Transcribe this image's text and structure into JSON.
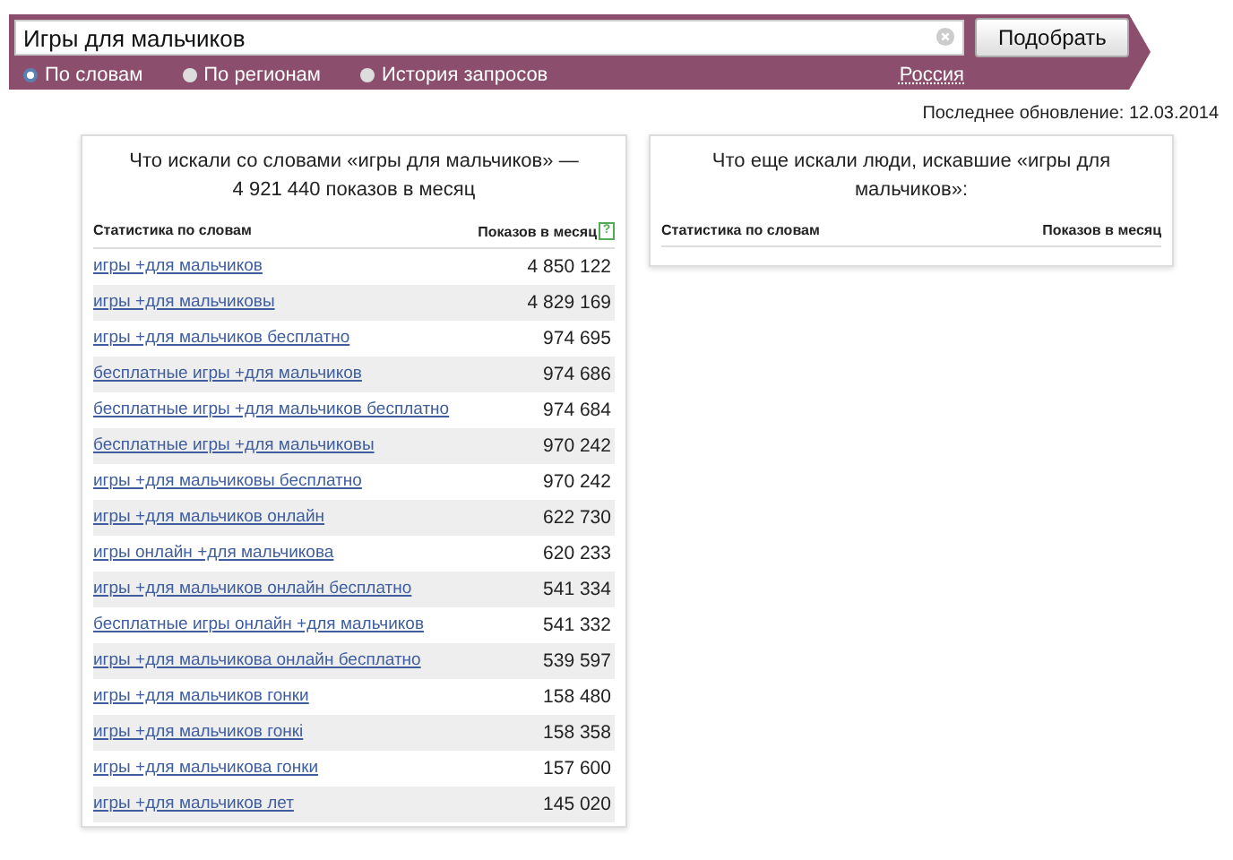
{
  "search": {
    "value": "Игры для мальчиков",
    "button": "Подобрать",
    "modes": [
      {
        "label": "По словам",
        "selected": true
      },
      {
        "label": "По регионам",
        "selected": false
      },
      {
        "label": "История запросов",
        "selected": false
      }
    ],
    "region": "Россия"
  },
  "last_update": "Последнее обновление: 12.03.2014",
  "left_panel": {
    "title": "Что искали со словами «игры для мальчиков» — 4 921 440 показов в месяц",
    "columns": [
      "Статистика по словам",
      "Показов в месяц"
    ],
    "help": "?",
    "rows": [
      {
        "phrase": "игры +для мальчиков",
        "count": "4 850 122"
      },
      {
        "phrase": "игры +для мальчиковы",
        "count": "4 829 169"
      },
      {
        "phrase": "игры +для мальчиков бесплатно",
        "count": "974 695"
      },
      {
        "phrase": "бесплатные игры +для мальчиков",
        "count": "974 686"
      },
      {
        "phrase": "бесплатные игры +для мальчиков бесплатно",
        "count": "974 684"
      },
      {
        "phrase": "бесплатные игры +для мальчиковы",
        "count": "970 242"
      },
      {
        "phrase": "игры +для мальчиковы бесплатно",
        "count": "970 242"
      },
      {
        "phrase": "игры +для мальчиков онлайн",
        "count": "622 730"
      },
      {
        "phrase": "игры онлайн +для мальчикова",
        "count": "620 233"
      },
      {
        "phrase": "игры +для мальчиков онлайн бесплатно",
        "count": "541 334"
      },
      {
        "phrase": "бесплатные игры онлайн +для мальчиков",
        "count": "541 332"
      },
      {
        "phrase": "игры +для мальчикова онлайн бесплатно",
        "count": "539 597"
      },
      {
        "phrase": "игры +для мальчиков гонки",
        "count": "158 480"
      },
      {
        "phrase": "игры +для мальчиков гонкі",
        "count": "158 358"
      },
      {
        "phrase": "игры +для мальчикова гонки",
        "count": "157 600"
      },
      {
        "phrase": "игры +для мальчиков лет",
        "count": "145 020"
      }
    ]
  },
  "right_panel": {
    "title": "Что еще искали люди, искавшие «игры для мальчиков»:",
    "columns": [
      "Статистика по словам",
      "Показов в месяц"
    ]
  }
}
